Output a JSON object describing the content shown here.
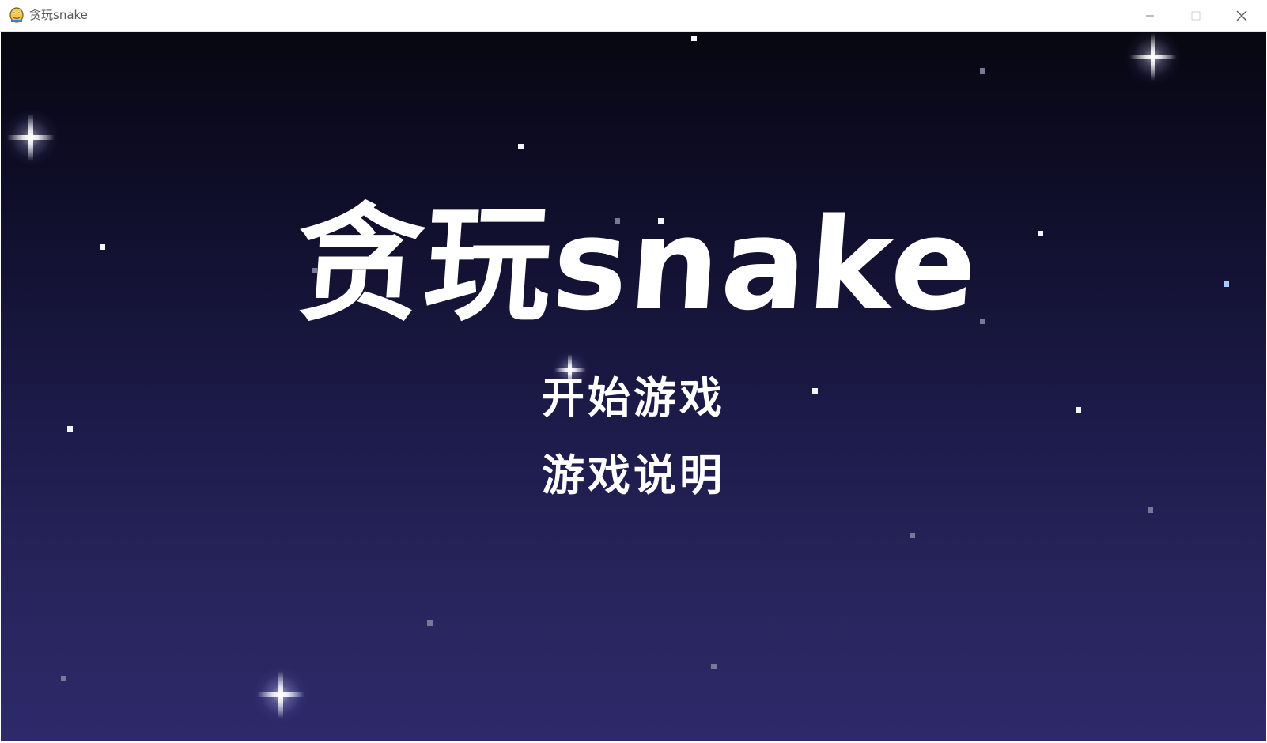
{
  "window": {
    "title": "贪玩snake",
    "app_icon": "python-snake-icon",
    "controls": [
      "minimize-icon",
      "maximize-icon",
      "close-icon"
    ]
  },
  "game": {
    "title": "贪玩snake",
    "menu": {
      "start_label": "开始游戏",
      "help_label": "游戏说明"
    }
  },
  "colors": {
    "sky_top": "#070711",
    "sky_bottom": "#2e2a6a",
    "text": "#ffffff"
  }
}
